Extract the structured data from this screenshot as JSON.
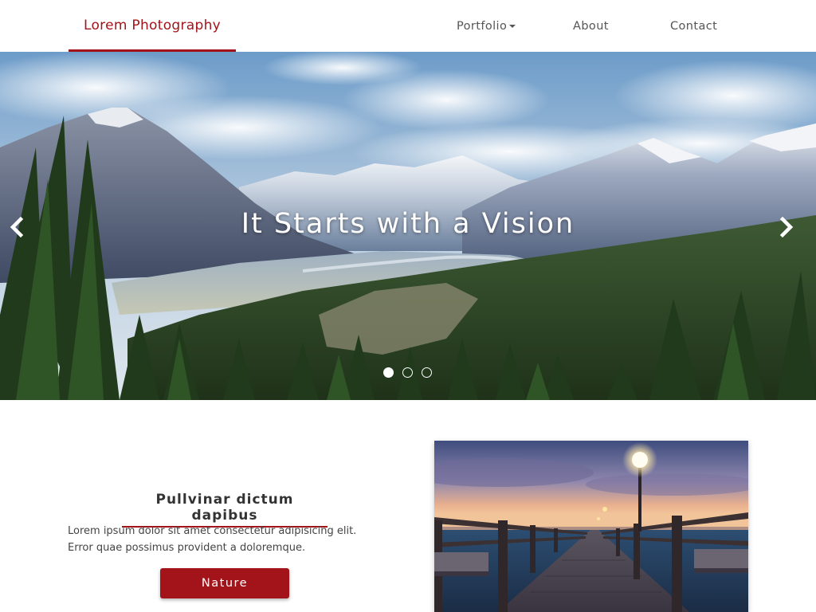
{
  "navbar": {
    "brand": "Lorem Photography",
    "items": [
      {
        "label": "Portfolio",
        "has_dropdown": true
      },
      {
        "label": "About"
      },
      {
        "label": "Contact"
      }
    ]
  },
  "hero": {
    "caption": "It Starts with a Vision",
    "slide_count": 3,
    "active_slide": 1,
    "prev_icon": "chevron-left-icon",
    "next_icon": "chevron-right-icon"
  },
  "feature": {
    "title": "Pullvinar dictum dapibus",
    "text": "Lorem ipsum dolor sit amet consectetur adipisicing elit. Error quae possimus provident a doloremque.",
    "button_label": "Nature"
  },
  "colors": {
    "accent": "#a3131a",
    "nav_text": "#555555",
    "body_text": "#444444"
  }
}
